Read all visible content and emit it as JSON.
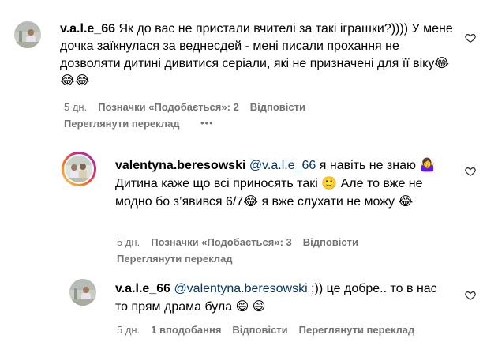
{
  "comments": [
    {
      "username": "v.a.l.e_66",
      "text": "Як до вас не пристали вчителі за такі іграшки?)))) У мене дочка заїкнулася за веднесдей - мені писали прохання не дозволяти дитині дивитися серіали, які не призначені для її віку😂😂😂",
      "age": "5 дн.",
      "likes": "Позначки «Подобається»: 2",
      "reply": "Відповісти",
      "translate": "Переглянути переклад",
      "more": "•••"
    },
    {
      "username": "valentyna.beresowski",
      "mention": "@v.a.l.e_66",
      "text_1": " я навіть не знаю ",
      "emoji_1": "🤷‍♀️",
      "text_2": " Дитина каже що всі приносять такі ",
      "emoji_2": "🙂",
      "text_3": " Але то вже не модно бо з’явився 6/7",
      "emoji_3": "😂",
      "text_4": " я вже слухати не можу ",
      "emoji_4": "😂",
      "age": "5 дн.",
      "likes": "Позначки «Подобається»: 3",
      "reply": "Відповісти",
      "translate": "Переглянути переклад"
    },
    {
      "username": "v.a.l.e_66",
      "mention": "@valentyna.beresowski",
      "text_1": " ;)) це добре.. то в нас то прям драма була ",
      "emoji_1": "😄",
      "emoji_2": "😄",
      "age": "5 дн.",
      "likes": "1 вподобання",
      "reply": "Відповісти",
      "translate": "Переглянути переклад"
    }
  ],
  "icons": {
    "like": "heart-outline-icon",
    "avatar_1": "user-avatar-photo",
    "avatar_2": "user-avatar-photo-with-story-ring"
  },
  "colors": {
    "primary_text": "#000000",
    "secondary_text": "#737373",
    "mention": "#00376b",
    "story_ring_start": "#feda75",
    "story_ring_end": "#d62976"
  }
}
